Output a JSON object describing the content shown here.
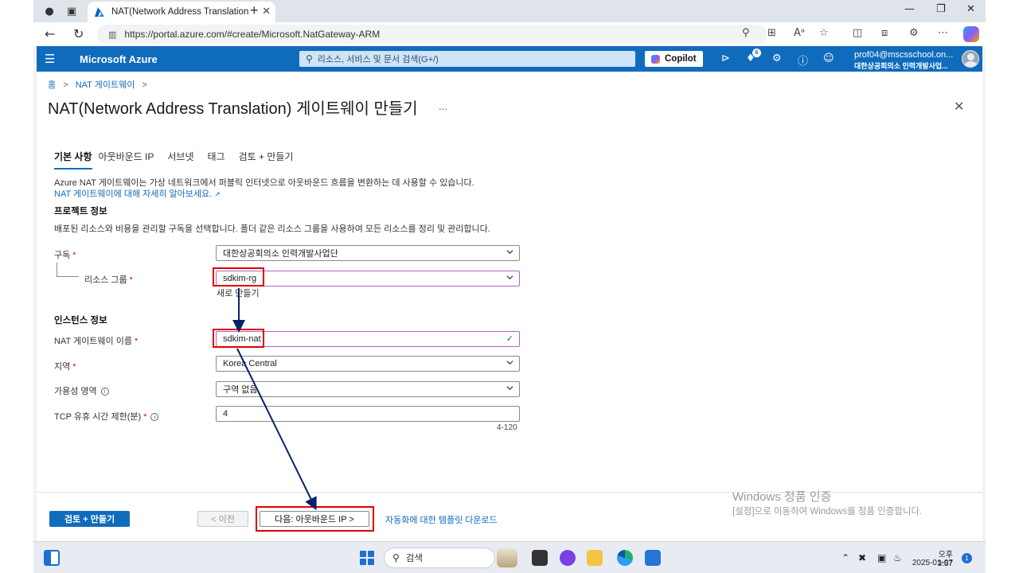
{
  "browser": {
    "tab_title": "NAT(Network Address Translation",
    "url": "https://portal.azure.com/#create/Microsoft.NatGateway-ARM"
  },
  "portal": {
    "brand": "Microsoft Azure",
    "search_placeholder": "리소스, 서비스 및 문서 검색(G+/)",
    "copilot_label": "Copilot",
    "notification_count": "6",
    "account_email": "prof04@mscsschool.on...",
    "account_org": "대한상공회의소 인력개발사업..."
  },
  "breadcrumb": {
    "home": "홈",
    "current": "NAT 게이트웨이",
    "sep": ">"
  },
  "page": {
    "title": "NAT(Network Address Translation) 게이트웨이 만들기",
    "more": "...",
    "close": "✕"
  },
  "tabs": [
    "기본 사항",
    "아웃바운드 IP",
    "서브넷",
    "태그",
    "검토 + 만들기"
  ],
  "intro": {
    "text": "Azure NAT 게이트웨이는 가상 네트워크에서 퍼블릭 인터넷으로 아웃바운드 흐름을 변환하는 데 사용할 수 있습니다.",
    "link": "NAT 게이트웨이에 대해 자세히 알아보세요."
  },
  "project": {
    "heading": "프로젝트 정보",
    "desc": "배포된 리소스와 비용을 관리할 구독을 선택합니다. 폴더 같은 리소스 그룹을 사용하여 모든 리소스를 정리 및 관리합니다.",
    "subscription_label": "구독",
    "subscription_value": "대한상공회의소 인력개발사업단",
    "rg_label": "리소스 그룹",
    "rg_value": "sdkim-rg",
    "rg_create_new": "새로 만들기"
  },
  "instance": {
    "heading": "인스턴스 정보",
    "name_label": "NAT 게이트웨이 이름",
    "name_value": "sdkim-nat",
    "region_label": "지역",
    "region_value": "Korea Central",
    "zone_label": "가용성 영역",
    "zone_value": "구역 없음",
    "tcp_label": "TCP 유휴 시간 제한(분)",
    "tcp_value": "4",
    "tcp_range": "4-120"
  },
  "footer": {
    "review_create": "검토 + 만들기",
    "previous": "< 이전",
    "next": "다음: 아웃바운드 IP >",
    "template_link": "자동화에 대한 템플릿 다운로드"
  },
  "watermark": {
    "title": "Windows 정품 인증",
    "subtitle": "[설정]으로 이동하여 Windows를 정품 인증합니다."
  },
  "taskbar": {
    "search": "검색",
    "time": "오후 3:57",
    "date": "2025-01-07",
    "badge": "1"
  },
  "colors": {
    "azure_blue": "#0f6cbd",
    "annotation_red": "#e00000",
    "arrow_navy": "#0b1f6b",
    "field_focus": "#b163c9"
  }
}
